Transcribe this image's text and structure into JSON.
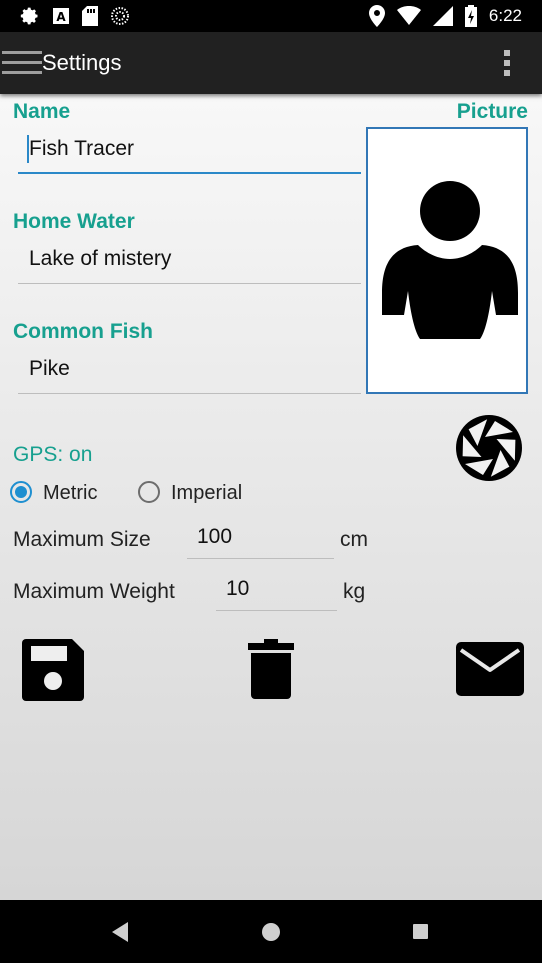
{
  "status_bar": {
    "time": "6:22",
    "left_icons": [
      "gear-icon",
      "a-text-icon",
      "sd-card-icon",
      "dotted-circle-icon"
    ],
    "right_icons": [
      "location-icon",
      "wifi-icon",
      "signal-icon",
      "battery-charging-icon"
    ]
  },
  "toolbar": {
    "title": "Settings"
  },
  "form": {
    "name_label": "Name",
    "name_value": "Fish Tracer",
    "home_water_label": "Home Water",
    "home_water_value": "Lake of mistery",
    "common_fish_label": "Common Fish",
    "common_fish_value": "Pike",
    "picture_label": "Picture"
  },
  "gps": {
    "status": "GPS: on"
  },
  "units": {
    "options": [
      "Metric",
      "Imperial"
    ],
    "selected": "Metric"
  },
  "max_size": {
    "label": "Maximum Size",
    "value": "100",
    "unit": "cm"
  },
  "max_weight": {
    "label": "Maximum Weight",
    "value": "10",
    "unit": "kg"
  },
  "colors": {
    "accent": "#17a08f",
    "toolbar": "#212121",
    "input_focus": "#2a88c8",
    "picture_border": "#3277b6"
  }
}
